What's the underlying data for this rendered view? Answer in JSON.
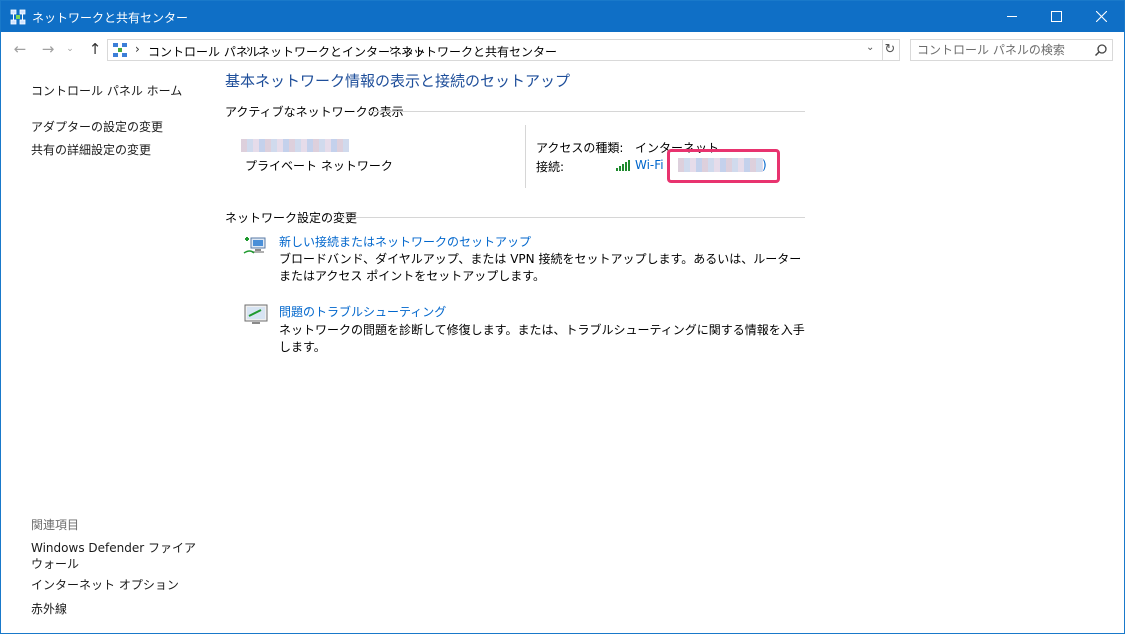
{
  "window": {
    "title": "ネットワークと共有センター",
    "icon": "network-center-icon",
    "controls": {
      "minimize": "minimize-icon",
      "maximize": "maximize-icon",
      "close": "close-icon"
    }
  },
  "nav": {
    "back_icon": "←",
    "forward_icon": "→",
    "recent_icon": "⌄",
    "up_icon": "↑",
    "breadcrumb": [
      "コントロール パネル",
      "ネットワークとインターネット",
      "ネットワークと共有センター"
    ],
    "separator": "›",
    "dropdown_icon": "⌄",
    "refresh_icon": "↻",
    "search_placeholder": "コントロール パネルの検索"
  },
  "sidebar": {
    "home": "コントロール パネル ホーム",
    "items": [
      "アダプターの設定の変更",
      "共有の詳細設定の変更"
    ],
    "related_label": "関連項目",
    "related": [
      "Windows Defender ファイアウォール",
      "インターネット オプション",
      "赤外線"
    ]
  },
  "main": {
    "title": "基本ネットワーク情報の表示と接続のセットアップ",
    "active_section": "アクティブなネットワークの表示",
    "network_type": "プライベート ネットワーク",
    "access_type_label": "アクセスの種類:",
    "access_type_value": "インターネット",
    "connection_label": "接続:",
    "connection_value": "Wi-Fi",
    "connection_suffix": ")",
    "change_section": "ネットワーク設定の変更",
    "tasks": [
      {
        "link": "新しい接続またはネットワークのセットアップ",
        "desc": "ブロードバンド、ダイヤルアップ、または VPN 接続をセットアップします。あるいは、ルーターまたはアクセス ポイントをセットアップします。",
        "icon": "new-connection-icon"
      },
      {
        "link": "問題のトラブルシューティング",
        "desc": "ネットワークの問題を診断して修復します。または、トラブルシューティングに関する情報を入手します。",
        "icon": "troubleshoot-icon"
      }
    ]
  },
  "colors": {
    "titlebar": "#0f6fc6",
    "link": "#0066cc",
    "heading": "#1e4e9a",
    "highlight": "#e8336f",
    "wifi": "#1f8a2e"
  }
}
